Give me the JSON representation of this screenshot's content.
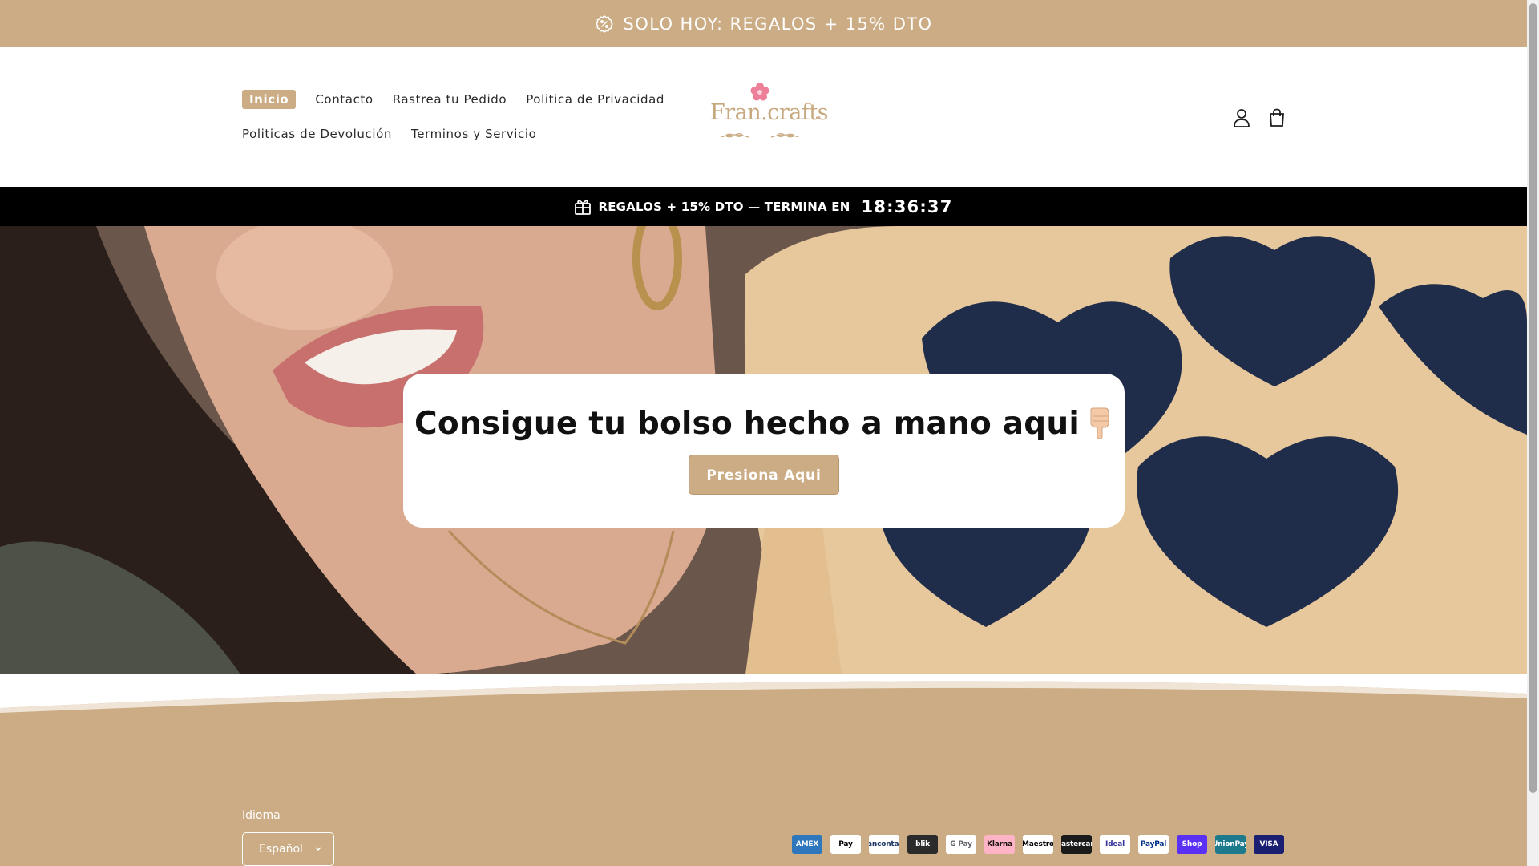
{
  "announcement": {
    "text": "SOLO HOY: REGALOS + 15% DTO",
    "icon": "discount-badge-icon"
  },
  "nav": {
    "row1": [
      "Inicio",
      "Contacto",
      "Rastrea tu Pedido",
      "Politica de Privacidad"
    ],
    "row2": [
      "Politicas de Devolución",
      "Terminos y Servicio"
    ],
    "active": "Inicio"
  },
  "logo": {
    "text": "Fran.crafts"
  },
  "header_icons": [
    "account-icon",
    "cart-icon"
  ],
  "countdown": {
    "label": "REGALOS + 15% DTO — TERMINA EN",
    "timer": "18:36:37",
    "icon": "gift-icon"
  },
  "hero": {
    "title": "Consigue tu bolso hecho a mano aqui",
    "button": "Presiona Aqui",
    "emoji_icon": "pointing-down-hand-icon"
  },
  "footer": {
    "language_label": "Idioma",
    "language_value": "Español",
    "payment_methods": [
      {
        "name": "AMEX",
        "bg": "#2e77bc",
        "fg": "#ffffff"
      },
      {
        "name": "Pay",
        "bg": "#ffffff",
        "fg": "#000000"
      },
      {
        "name": "Bancontact",
        "bg": "#ffffff",
        "fg": "#1e3764"
      },
      {
        "name": "blik",
        "bg": "#2b2b2b",
        "fg": "#ffffff"
      },
      {
        "name": "G Pay",
        "bg": "#ffffff",
        "fg": "#5f6368"
      },
      {
        "name": "Klarna",
        "bg": "#ffb3c7",
        "fg": "#17120f"
      },
      {
        "name": "Maestro",
        "bg": "#ffffff",
        "fg": "#000000"
      },
      {
        "name": "Mastercard",
        "bg": "#1a1a1a",
        "fg": "#ffffff"
      },
      {
        "name": "Ideal",
        "bg": "#ffffff",
        "fg": "#333399"
      },
      {
        "name": "PayPal",
        "bg": "#ffffff",
        "fg": "#003087"
      },
      {
        "name": "Shop",
        "bg": "#5a31f4",
        "fg": "#ffffff"
      },
      {
        "name": "UnionPay",
        "bg": "#1c7a8c",
        "fg": "#ffffff"
      },
      {
        "name": "VISA",
        "bg": "#1a1f71",
        "fg": "#ffffff"
      }
    ]
  },
  "colors": {
    "accent": "#cbac84",
    "countdown_bg": "#000000",
    "text": "#1e1e1e"
  }
}
